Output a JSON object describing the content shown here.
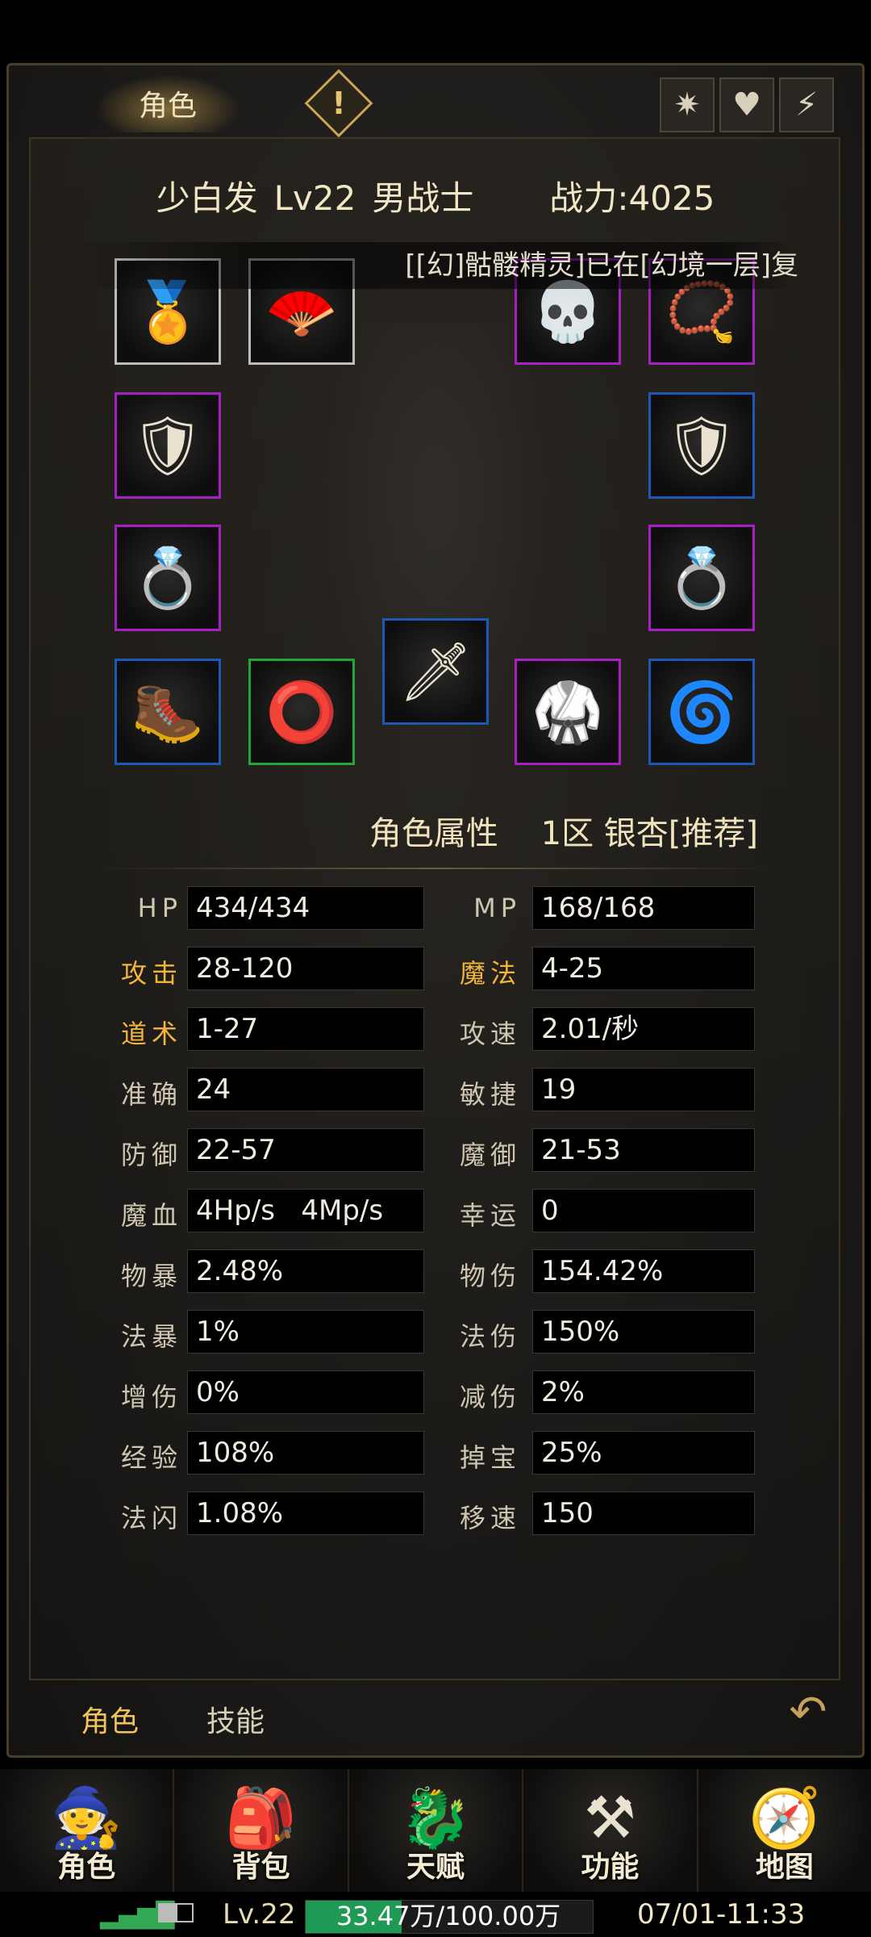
{
  "top_tab": "角色",
  "top_icons": [
    "sparkle-icon",
    "heart-icon",
    "lightning-icon"
  ],
  "character": {
    "name": "少白发",
    "level": "Lv22",
    "class": "男战士",
    "power": "战力:4025"
  },
  "ticker": "[[幻]骷髅精灵]已在[幻境一层]复",
  "equipment": [
    {
      "name": "medallion",
      "icon": "🏅",
      "quality": "white"
    },
    {
      "name": "shoulder",
      "icon": "🪭",
      "quality": "white"
    },
    {
      "name": "helmet",
      "icon": "💀",
      "quality": "purple"
    },
    {
      "name": "necklace",
      "icon": "📿",
      "quality": "purple"
    },
    {
      "name": "bracer-left",
      "icon": "🛡",
      "quality": "purple"
    },
    {
      "name": "bracer-right",
      "icon": "🛡",
      "quality": "blue"
    },
    {
      "name": "ring-left",
      "icon": "💍",
      "quality": "purple"
    },
    {
      "name": "ring-right",
      "icon": "💍",
      "quality": "purple"
    },
    {
      "name": "boots",
      "icon": "🥾",
      "quality": "blue"
    },
    {
      "name": "belt",
      "icon": "⭕",
      "quality": "green"
    },
    {
      "name": "weapon",
      "icon": "🗡",
      "quality": "blue"
    },
    {
      "name": "armor",
      "icon": "🥋",
      "quality": "purple"
    },
    {
      "name": "gem",
      "icon": "🌀",
      "quality": "blue"
    }
  ],
  "attributes_title": "角色属性",
  "server": "1区 银杏[推荐]",
  "stats_left": [
    {
      "label": "HP",
      "value": "434/434",
      "highlight": false
    },
    {
      "label": "攻击",
      "value": "28-120",
      "highlight": true
    },
    {
      "label": "道术",
      "value": "1-27",
      "highlight": true
    },
    {
      "label": "准确",
      "value": "24",
      "highlight": false
    },
    {
      "label": "防御",
      "value": "22-57",
      "highlight": false
    },
    {
      "label": "魔血",
      "value": "4Hp/s   4Mp/s",
      "highlight": false
    },
    {
      "label": "物暴",
      "value": "2.48%",
      "highlight": false
    },
    {
      "label": "法暴",
      "value": "1%",
      "highlight": false
    },
    {
      "label": "增伤",
      "value": "0%",
      "highlight": false
    },
    {
      "label": "经验",
      "value": "108%",
      "highlight": false
    },
    {
      "label": "法闪",
      "value": "1.08%",
      "highlight": false
    }
  ],
  "stats_right": [
    {
      "label": "MP",
      "value": "168/168",
      "highlight": false
    },
    {
      "label": "魔法",
      "value": "4-25",
      "highlight": true
    },
    {
      "label": "攻速",
      "value": "2.01/秒",
      "highlight": false
    },
    {
      "label": "敏捷",
      "value": "19",
      "highlight": false
    },
    {
      "label": "魔御",
      "value": "21-53",
      "highlight": false
    },
    {
      "label": "幸运",
      "value": "0",
      "highlight": false
    },
    {
      "label": "物伤",
      "value": "154.42%",
      "highlight": false
    },
    {
      "label": "法伤",
      "value": "150%",
      "highlight": false
    },
    {
      "label": "减伤",
      "value": "2%",
      "highlight": false
    },
    {
      "label": "掉宝",
      "value": "25%",
      "highlight": false
    },
    {
      "label": "移速",
      "value": "150",
      "highlight": false
    }
  ],
  "bottom_tabs": [
    "角色",
    "技能"
  ],
  "nav": [
    {
      "label": "角色",
      "icon": "🧙"
    },
    {
      "label": "背包",
      "icon": "🎒"
    },
    {
      "label": "天赋",
      "icon": "🐉"
    },
    {
      "label": "功能",
      "icon": "⚒"
    },
    {
      "label": "地图",
      "icon": "🧭"
    }
  ],
  "status_bar": {
    "level": "Lv.22",
    "exp_text": "33.47万/100.00万",
    "exp_fraction": 0.3347,
    "time": "07/01-11:33"
  }
}
